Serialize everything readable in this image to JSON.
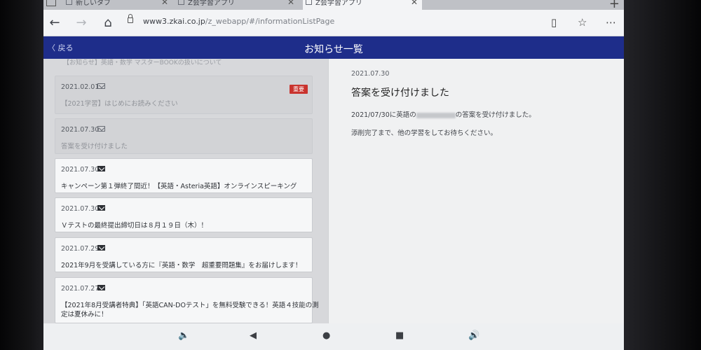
{
  "browser": {
    "tabs": [
      {
        "label": "新しいタブ"
      },
      {
        "label": "Z会学習アプリ"
      },
      {
        "label": "Z会学習アプリ"
      }
    ],
    "new_tab": "+",
    "url_domain": "www3.zkai.co.jp",
    "url_path": "/z_webapp/#/informationListPage"
  },
  "appbar": {
    "back_label": "〈  戻る",
    "title": "お知らせ一覧"
  },
  "list": {
    "top_fragment": "【お知らせ】英語・数学 マスターBOOKの扱いについて",
    "items": [
      {
        "date": "2021.02.01",
        "title": "【2021学習】はじめにお読みください",
        "badge": "重要",
        "read": true
      },
      {
        "date": "2021.07.30",
        "title": "答案を受け付けました",
        "read": true
      },
      {
        "date": "2021.07.30",
        "title": "キャンペーン第１弾終了間近！【英語・Asteria英語】オンラインスピーキング",
        "read": false
      },
      {
        "date": "2021.07.30",
        "title": "Ｖテストの最終提出締切日は８月１９日（木）！",
        "read": false
      },
      {
        "date": "2021.07.29",
        "title": "2021年9月を受講している方に『英語・数学　超重要問題集』をお届けします！",
        "read": false
      },
      {
        "date": "2021.07.27",
        "title": "【2021年8月受講者特典】「英語CAN-DOテスト」を無料受験できる！英語４技能の測",
        "title2": "定は夏休みに！",
        "read": false
      }
    ]
  },
  "detail": {
    "date": "2021.07.30",
    "title": "答案を受け付けました",
    "line1_pre": "2021/07/30に英語の",
    "line1_post": "の答案を受け付けました。",
    "line2": "添削完了まで、他の学習をしてお待ちください。"
  },
  "colors": {
    "appbar": "#1e2d8a",
    "badge": "#c9332e"
  }
}
